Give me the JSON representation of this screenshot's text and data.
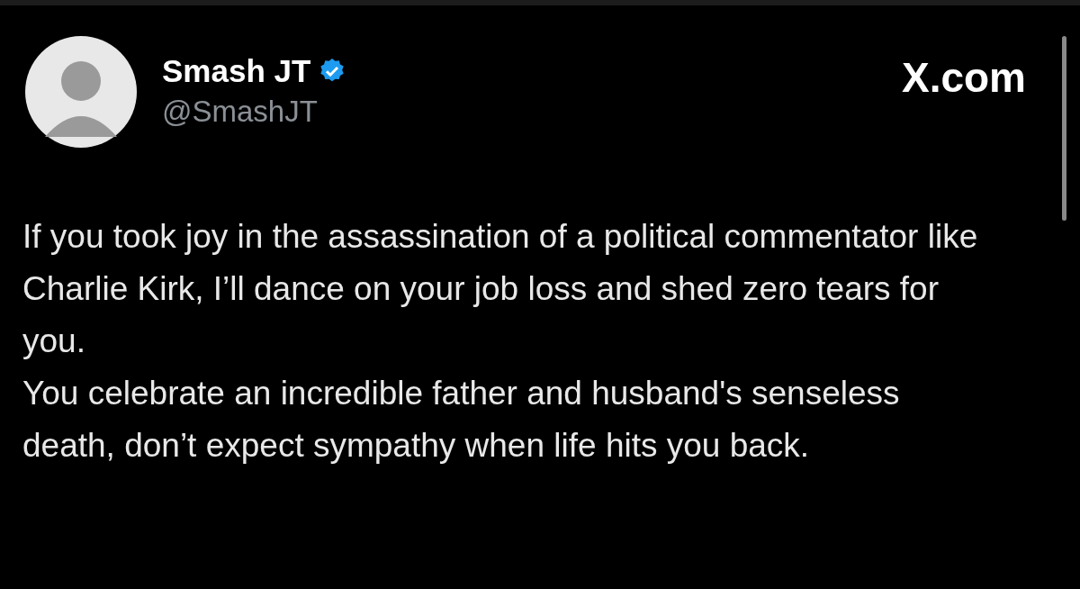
{
  "author": {
    "name": "Smash JT",
    "verified": true,
    "handle": "@SmashJT"
  },
  "site": "X.com",
  "paragraphs": [
    "If you took joy in the assassination of a political commentator like Charlie Kirk, I’ll dance on your job loss and shed zero tears for you.",
    "You celebrate an incredible father and husband's senseless death, don’t expect sympathy when life hits you back."
  ]
}
